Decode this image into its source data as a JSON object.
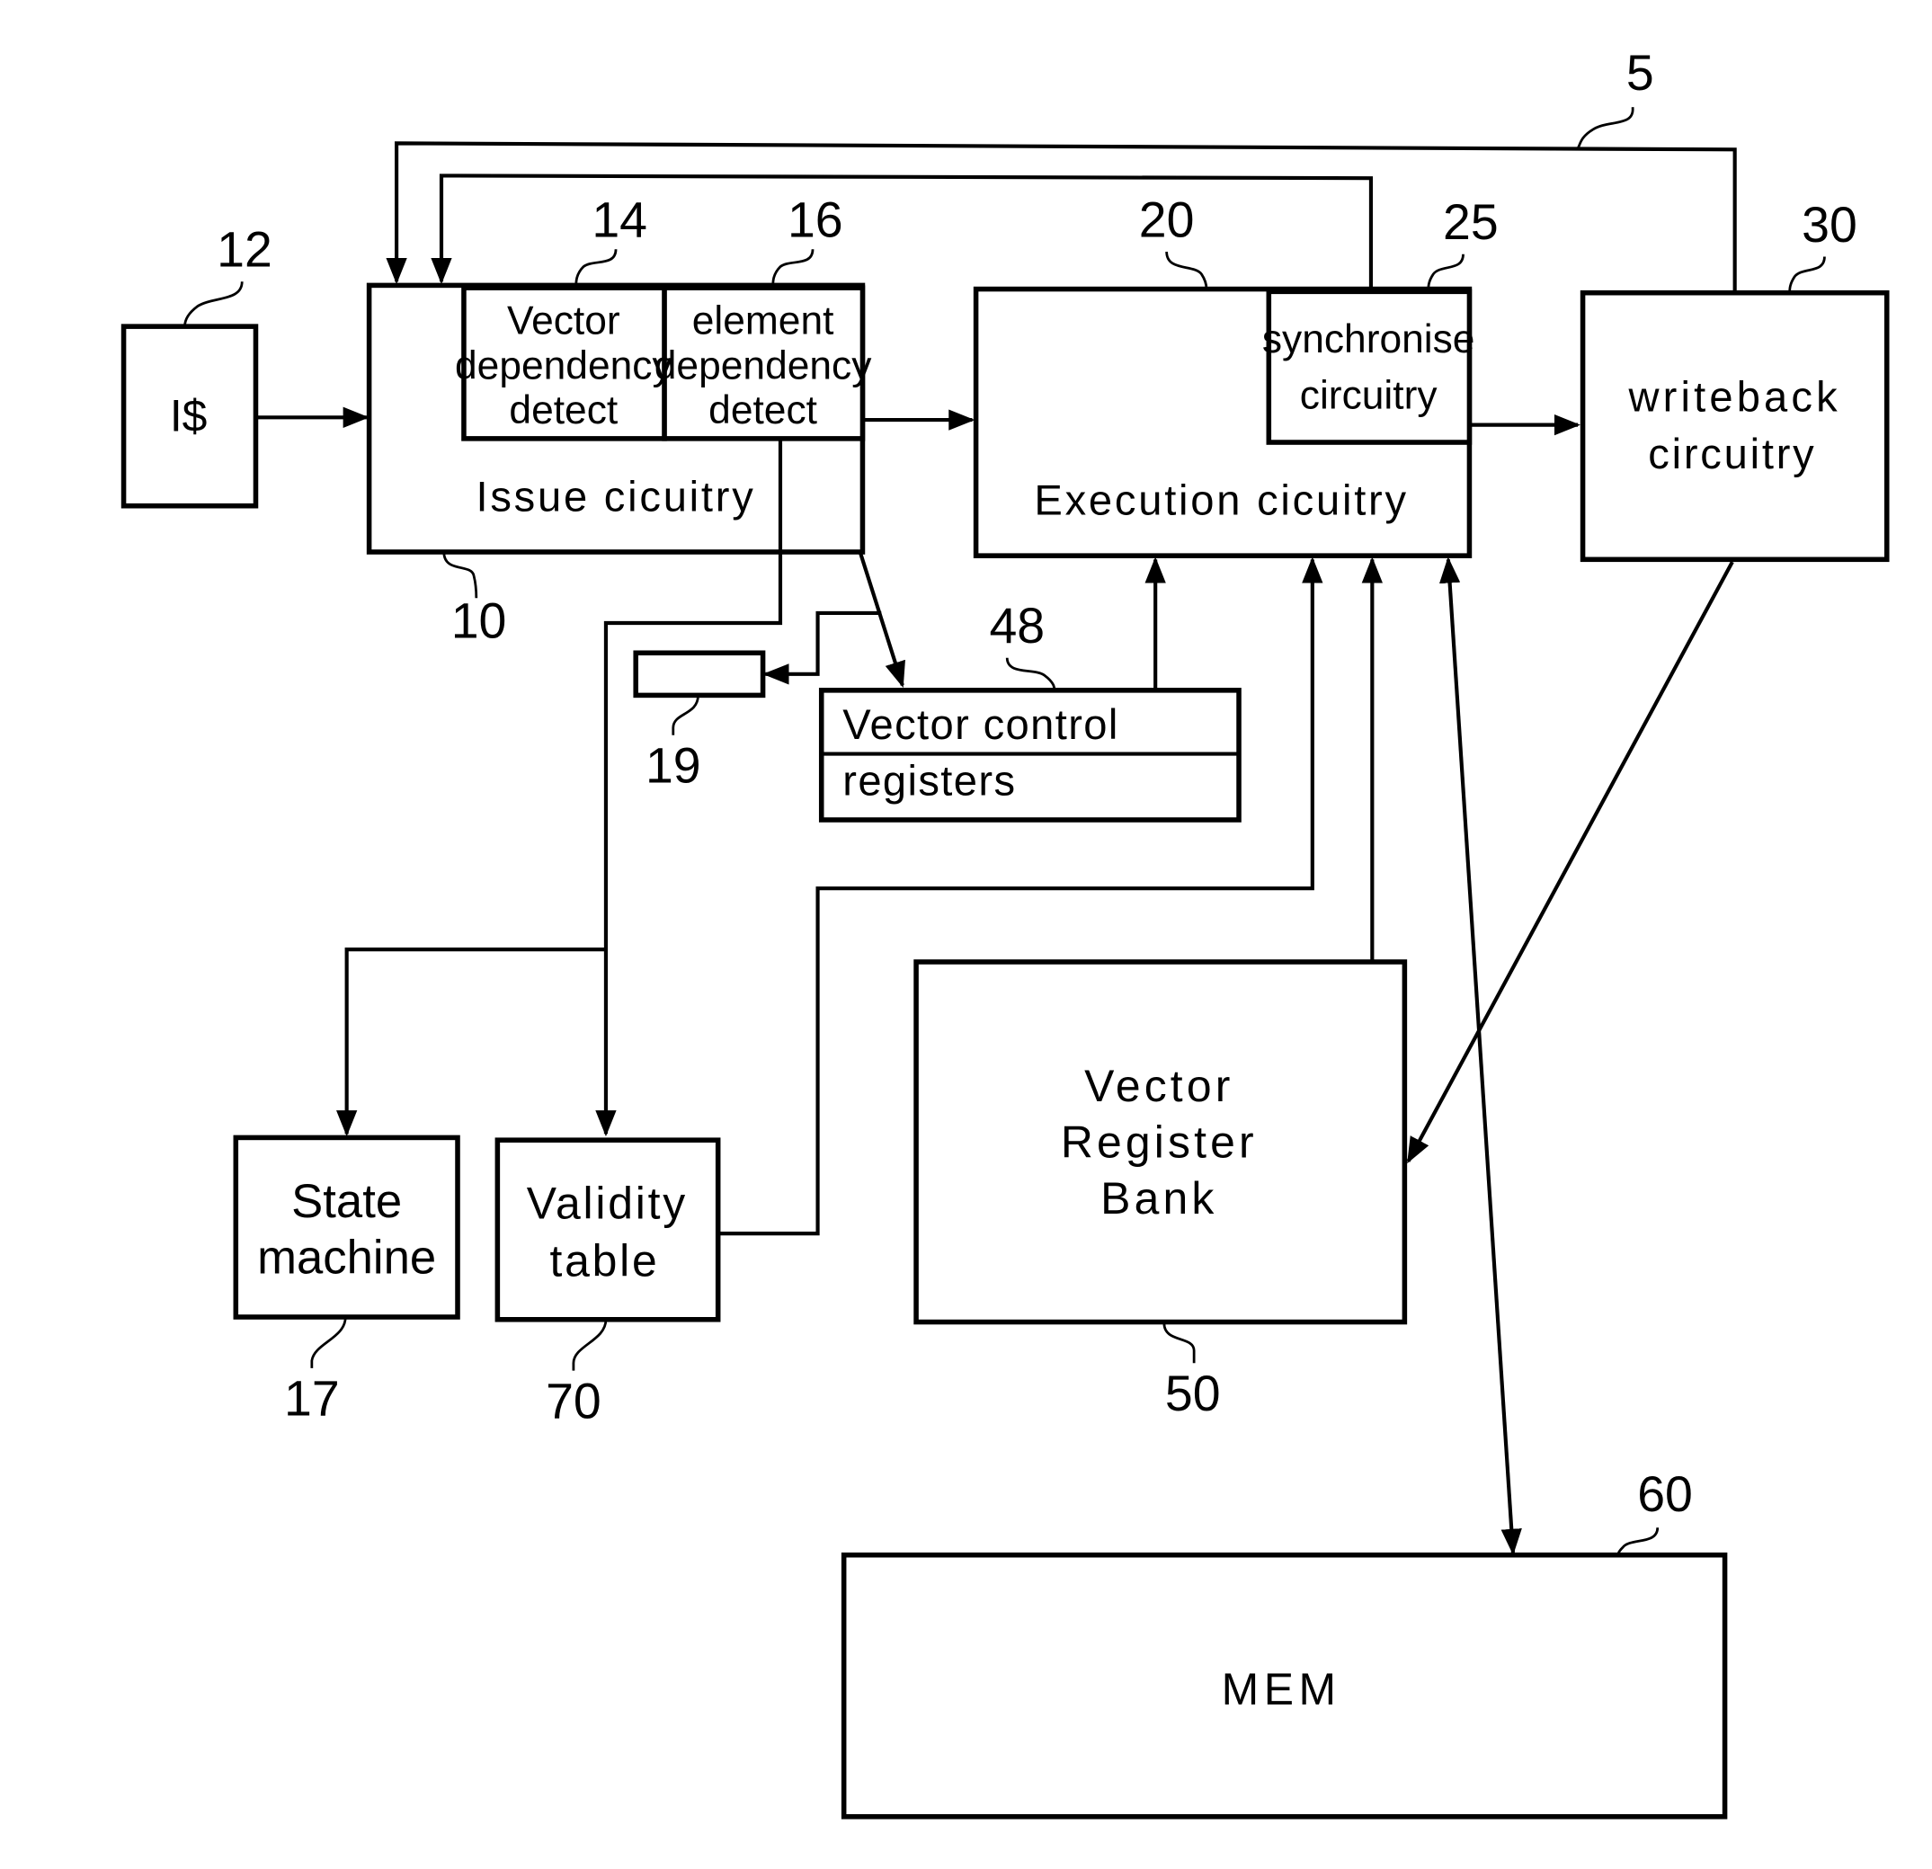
{
  "figure": {
    "ref_numbers": {
      "system": "5",
      "issue": "10",
      "icache": "12",
      "vector_dep": "14",
      "element_dep": "16",
      "state_machine": "17",
      "reg19": "19",
      "execution": "20",
      "synchronise": "25",
      "writeback": "30",
      "vcr": "48",
      "vrb": "50",
      "mem": "60",
      "validity": "70"
    },
    "blocks": {
      "icache": "I$",
      "issue": "Issue cicuitry",
      "vector_dep": [
        "Vector",
        "dependency",
        "detect"
      ],
      "element_dep": [
        "element",
        "dependency",
        "detect"
      ],
      "execution": "Execution cicuitry",
      "synchronise": [
        "synchronise",
        "circuitry"
      ],
      "writeback": [
        "writeback",
        "circuitry"
      ],
      "vcr": [
        "Vector control",
        "registers"
      ],
      "vrb": [
        "Vector",
        "Register",
        "Bank"
      ],
      "state_machine": [
        "State",
        "machine"
      ],
      "validity": [
        "Validity",
        "table"
      ],
      "mem": "MEM"
    }
  }
}
